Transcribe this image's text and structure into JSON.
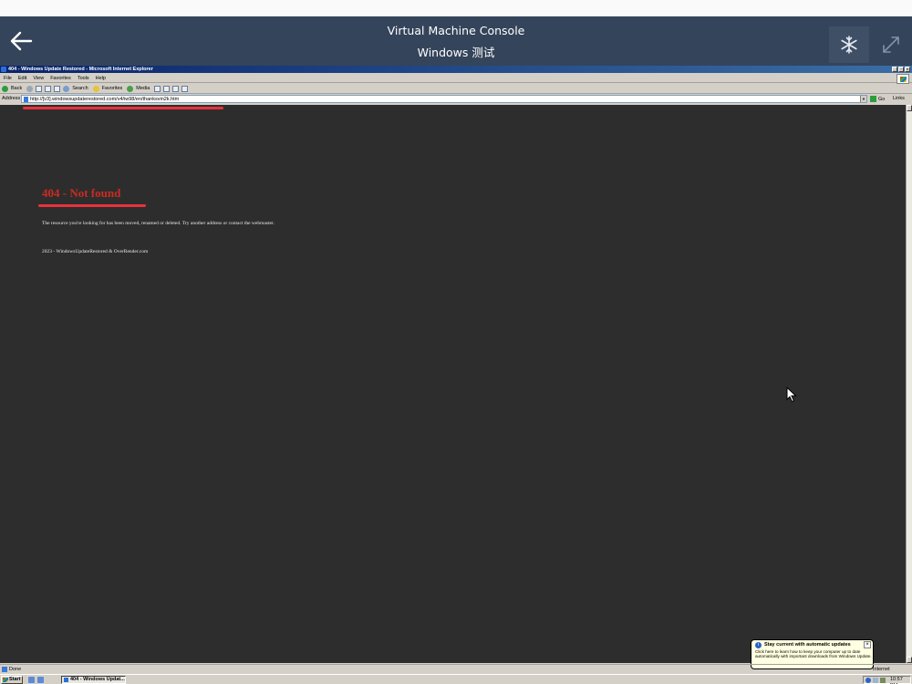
{
  "console": {
    "title": "Virtual Machine Console",
    "subtitle": "Windows 测试",
    "icons": {
      "back": "back-arrow-icon",
      "keys": "snowflake-icon",
      "expand": "expand-icon"
    }
  },
  "ie": {
    "window_title": "404 - Windows Update Restored - Microsoft Internet Explorer",
    "menu": [
      "File",
      "Edit",
      "View",
      "Favorites",
      "Tools",
      "Help"
    ],
    "toolbar": {
      "back": "Back",
      "search": "Search",
      "favorites": "Favorites",
      "media": "Media"
    },
    "address_label": "Address",
    "address_url": "http://[v3].windowsupdaterestored.com/v4/iw98/en/thanksvin2k.htm",
    "go_label": "Go",
    "links_label": "Links"
  },
  "page": {
    "heading": "404 - Not found",
    "message": "The resource you're looking for has been moved, renamed or deleted. Try another address or contact the webmaster.",
    "footer": "2023 - WindowsUpdateRestored & OverRender.com"
  },
  "balloon": {
    "title": "Stay current with automatic updates",
    "body": "Click here to learn how to keep your computer up to date automatically with important downloads from Windows Update."
  },
  "status": {
    "text": "Done",
    "zone": "Internet"
  },
  "taskbar": {
    "start": "Start",
    "task_button": "404 - Windows Updat...",
    "clock": "10:57 PM"
  },
  "colors": {
    "console_header": "#34445a",
    "page_bg": "#2d2d2d",
    "heading_red": "#cc2b22",
    "annotation_red": "#e8323c"
  }
}
